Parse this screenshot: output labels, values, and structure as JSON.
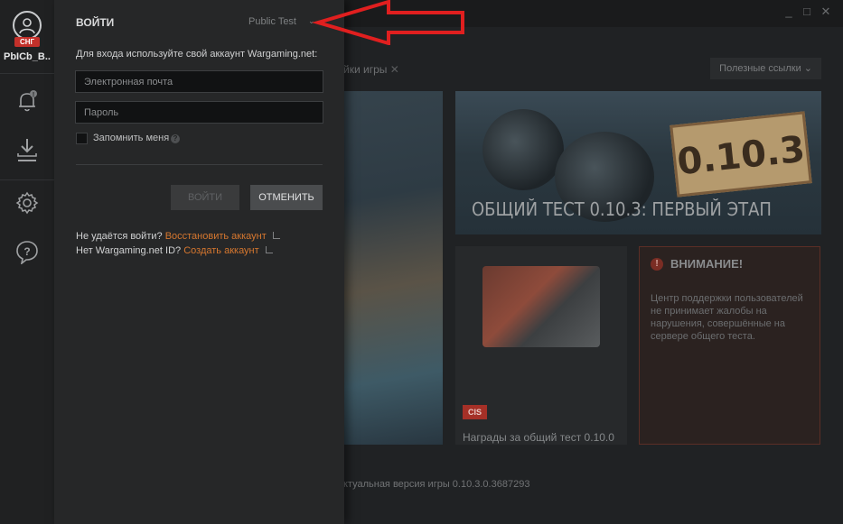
{
  "sidebar": {
    "region_badge": "СНГ",
    "user_name": "PbICb_B..."
  },
  "login": {
    "title": "ВОЙТИ",
    "server": "Public Test",
    "hint": "Для входа используйте свой аккаунт Wargaming.net:",
    "email_placeholder": "Электронная почта",
    "password_placeholder": "Пароль",
    "remember_label": "Запомнить меня",
    "login_button": "ВОЙТИ",
    "cancel_button": "ОТМЕНИТЬ",
    "cant_login_text": "Не удаётся войти?",
    "restore_link": "Восстановить аккаунт",
    "no_id_text": "Нет Wargaming.net ID?",
    "create_link": "Создать аккаунт"
  },
  "background": {
    "tab_label": "йки игры",
    "useful_links": "Полезные ссылки",
    "main_card_title": "ОБЩИЙ ТЕСТ 0.10.3: ПЕРВЫЙ ЭТАП",
    "version_badge": "0.10.3",
    "cis_badge": "CIS",
    "reward_caption": "Награды за общий тест 0.10.0",
    "warning_title": "ВНИМАНИЕ!",
    "warning_text": "Центр поддержки пользователей не принимает жалобы на нарушения, совершённые на сервере общего теста.",
    "version_line": "ктуальная версия игры  0.10.3.0.3687293"
  },
  "colors": {
    "accent_link": "#d6772f",
    "region_badge": "#c3302a",
    "annotation_arrow": "#e01f1f"
  }
}
